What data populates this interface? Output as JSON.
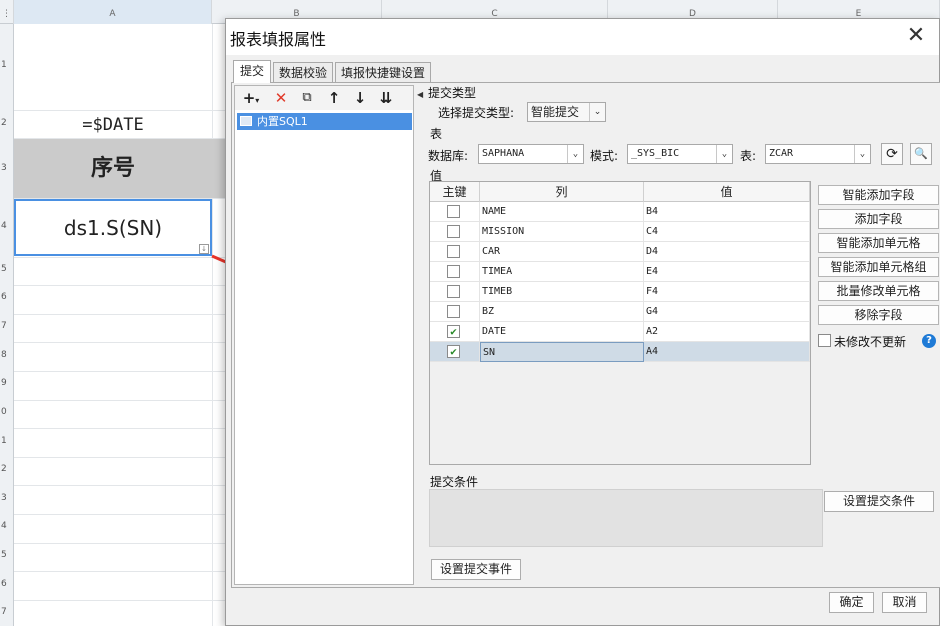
{
  "sheet": {
    "columns": [
      "A",
      "B",
      "C",
      "D",
      "E"
    ],
    "rows": [
      "1",
      "2",
      "3",
      "4",
      "5",
      "6",
      "7",
      "8",
      "9",
      "0",
      "1",
      "2",
      "3",
      "4",
      "5",
      "6",
      "7"
    ],
    "cell_date": "=$DATE",
    "cell_seq": "序号",
    "cell_sn": "ds1.S(SN)",
    "corner": "⋮"
  },
  "dialog": {
    "title": "报表填报属性",
    "tabs": [
      "提交",
      "数据校验",
      "填报快捷键设置"
    ],
    "left": {
      "item": "内置SQL1"
    },
    "section_submit_type": "提交类型",
    "select_type_label": "选择提交类型:",
    "submit_type_value": "智能提交",
    "section_table": "表",
    "db_label": "数据库:",
    "db_value": "SAPHANA",
    "schema_label": "模式:",
    "schema_value": "_SYS_BIC",
    "table_label": "表:",
    "table_value": "ZCAR",
    "section_value": "值",
    "grid_headers": [
      "主键",
      "列",
      "值"
    ],
    "rows": [
      {
        "key": false,
        "col": "NAME",
        "val": "B4"
      },
      {
        "key": false,
        "col": "MISSION",
        "val": "C4"
      },
      {
        "key": false,
        "col": "CAR",
        "val": "D4"
      },
      {
        "key": false,
        "col": "TIMEA",
        "val": "E4"
      },
      {
        "key": false,
        "col": "TIMEB",
        "val": "F4"
      },
      {
        "key": false,
        "col": "BZ",
        "val": "G4"
      },
      {
        "key": true,
        "col": "DATE",
        "val": "A2"
      },
      {
        "key": true,
        "col": "SN",
        "val": "A4"
      }
    ],
    "right_buttons": [
      "智能添加字段",
      "添加字段",
      "智能添加单元格",
      "智能添加单元格组",
      "批量修改单元格",
      "移除字段"
    ],
    "no_update_label": "未修改不更新",
    "section_condition": "提交条件",
    "set_condition": "设置提交条件",
    "set_event": "设置提交事件",
    "ok": "确定",
    "cancel": "取消"
  },
  "colors": {
    "accent": "#4a90e2",
    "arrow": "#e8342a",
    "help": "#1e7ad6"
  }
}
